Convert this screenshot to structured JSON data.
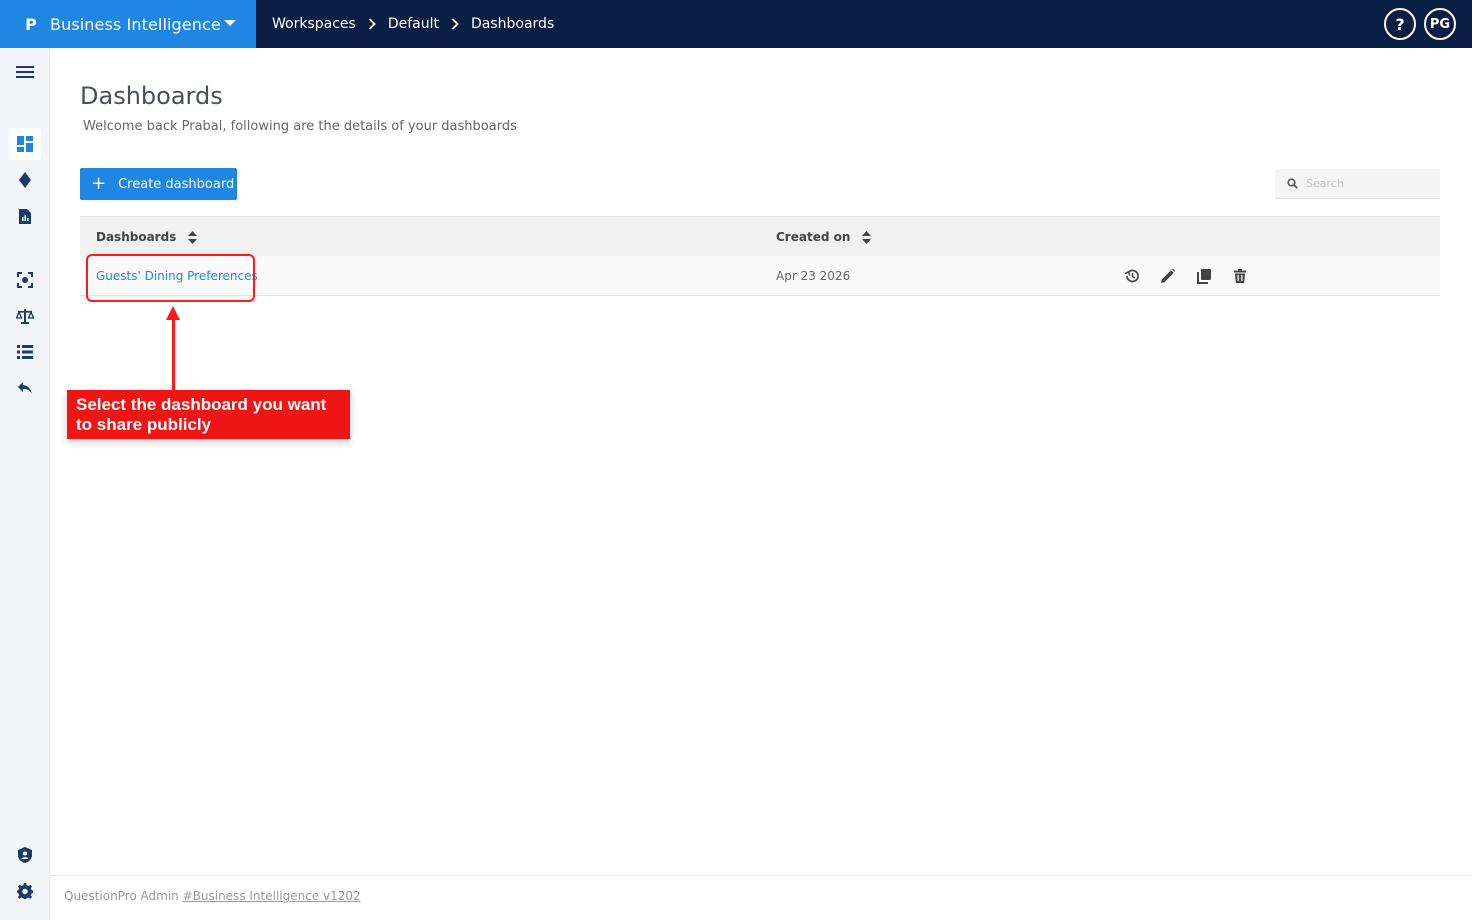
{
  "app": {
    "logo": "P",
    "title": "Business Intelligence"
  },
  "breadcrumb": [
    "Workspaces",
    "Default",
    "Dashboards"
  ],
  "top_actions": {
    "help": "?",
    "avatar": "PG"
  },
  "sidebar": {
    "items": [
      {
        "icon": "menu-icon"
      },
      {
        "icon": "dashboard-icon",
        "active": true
      },
      {
        "icon": "diamond-icon"
      },
      {
        "icon": "report-icon"
      },
      {
        "icon": "scan-icon"
      },
      {
        "icon": "balance-scale-icon"
      },
      {
        "icon": "list-icon"
      },
      {
        "icon": "reply-icon"
      },
      {
        "icon": "shield-icon"
      },
      {
        "icon": "gear-icon"
      }
    ]
  },
  "main": {
    "title": "Dashboards",
    "subtitle": "Welcome back Prabal, following are the details of your dashboards",
    "create_button": "Create dashboard",
    "search_placeholder": "Search"
  },
  "table": {
    "columns": [
      "Dashboards",
      "Created on"
    ],
    "rows": [
      {
        "name": "Guests' Dining Preferences",
        "created_on": "Apr 23 2026"
      }
    ]
  },
  "annotation": {
    "text": "Select the dashboard you want to share publicly"
  },
  "footer": {
    "text": "QuestionPro Admin ",
    "link": "#Business Intelligence v1202"
  },
  "colors": {
    "topbar": "#0b1f44",
    "accent": "#1f86e3",
    "annotation": "#f01515"
  }
}
